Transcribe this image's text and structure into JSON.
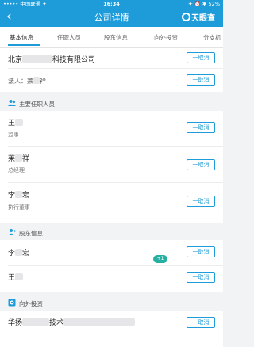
{
  "status_bar": {
    "carrier": "••••• 中国联通 ✦",
    "time": "16:34",
    "battery": "✈ ⏰ ✱ 52%"
  },
  "nav": {
    "back_glyph": "‹",
    "title": "公司详情",
    "logo_text": "天眼查"
  },
  "tabs": [
    {
      "label": "基本信息"
    },
    {
      "label": "任职人员"
    },
    {
      "label": "股东信息"
    },
    {
      "label": "向外投资"
    },
    {
      "label": "分支机"
    }
  ],
  "company": {
    "name_prefix": "北京",
    "name_suffix": "科技有限公司",
    "legal_label": "法人：",
    "legal_name_a": "莱",
    "legal_name_b": "祥"
  },
  "cancel_label": "一取消",
  "sections": {
    "staff": "主要任职人员",
    "shareholders": "股东信息",
    "investment": "向外投资"
  },
  "staff": [
    {
      "name": "王",
      "role": "监事"
    },
    {
      "name": "莱",
      "name2": "祥",
      "role": "总经理"
    },
    {
      "name": "李",
      "name2": "宏",
      "role": "执行董事"
    }
  ],
  "shareholders": [
    {
      "name": "李",
      "name2": "宏",
      "badge": "+1"
    },
    {
      "name": "王"
    }
  ],
  "investment": {
    "name_prefix": "华扬",
    "name_mid": "技术"
  }
}
